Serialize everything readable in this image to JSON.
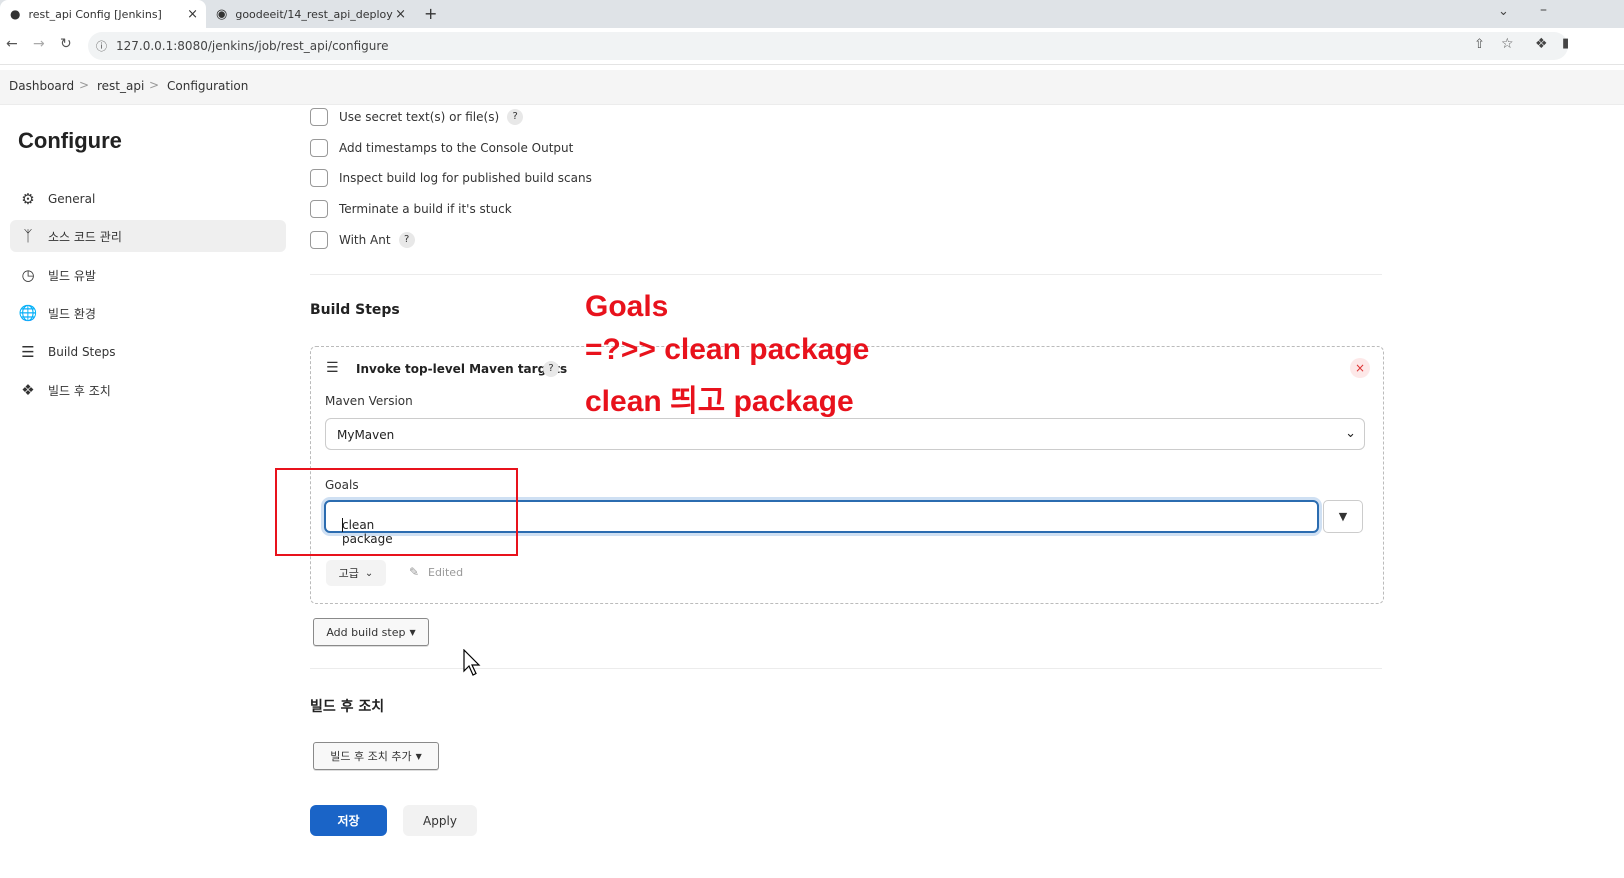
{
  "browser": {
    "tabs": [
      {
        "title": "rest_api Config [Jenkins]",
        "close": "×"
      },
      {
        "title": "goodeeit/14_rest_api_deploy",
        "close": "×"
      }
    ],
    "new_tab": "+",
    "url": "127.0.0.1:8080/jenkins/job/rest_api/configure"
  },
  "breadcrumb": {
    "items": [
      "Dashboard",
      "rest_api",
      "Configuration"
    ],
    "separator": ">"
  },
  "sidebar": {
    "title": "Configure",
    "items": [
      {
        "label": "General",
        "icon": "gear-icon"
      },
      {
        "label": "소스 코드 관리",
        "icon": "branch-icon"
      },
      {
        "label": "빌드 유발",
        "icon": "clock-icon"
      },
      {
        "label": "빌드 환경",
        "icon": "globe-icon"
      },
      {
        "label": "Build Steps",
        "icon": "list-icon"
      },
      {
        "label": "빌드 후 조치",
        "icon": "cube-icon"
      }
    ]
  },
  "build_env_options": [
    {
      "label": "Use secret text(s) or file(s)",
      "help": "?"
    },
    {
      "label": "Add timestamps to the Console Output"
    },
    {
      "label": "Inspect build log for published build scans"
    },
    {
      "label": "Terminate a build if it's stuck"
    },
    {
      "label": "With Ant",
      "help": "?"
    }
  ],
  "build_steps": {
    "title": "Build Steps",
    "step": {
      "title": "Invoke top-level Maven targets",
      "help": "?",
      "delete": "×",
      "maven_version_label": "Maven Version",
      "maven_version_value": "MyMaven",
      "goals_label": "Goals",
      "goals_value": "clean package",
      "advanced_label": "고급",
      "edited_label": "Edited"
    },
    "add_button": "Add build step"
  },
  "post_build": {
    "title": "빌드 후 조치",
    "add_button": "빌드 후 조치 추가"
  },
  "actions": {
    "save": "저장",
    "apply": "Apply"
  },
  "annotation": {
    "lines": [
      "Goals",
      "=?>> clean package",
      "clean 띄고 package"
    ],
    "color": "#e8121c"
  }
}
